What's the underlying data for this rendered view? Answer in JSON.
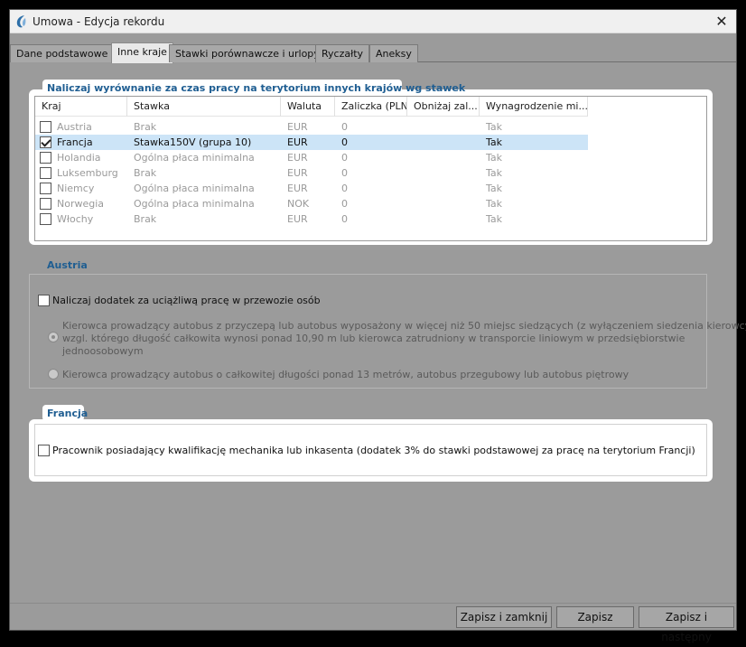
{
  "window": {
    "title": "Umowa - Edycja rekordu"
  },
  "tabs": [
    {
      "label": "Dane podstawowe"
    },
    {
      "label": "Inne kraje"
    },
    {
      "label": "Stawki porównawcze i urlopy"
    },
    {
      "label": "Ryczałty"
    },
    {
      "label": "Aneksy"
    }
  ],
  "countries_group": {
    "title": "Naliczaj wyrównanie za czas pracy na terytorium innych krajów wg stawek",
    "columns": [
      "Kraj",
      "Stawka",
      "Waluta",
      "Zaliczka (PLN)",
      "Obniżaj zal...",
      "Wynagrodzenie mi..."
    ],
    "rows": [
      {
        "checked": false,
        "country": "Austria",
        "rate": "Brak",
        "currency": "EUR",
        "advance": "0",
        "reduce": "",
        "min_wage": "Tak"
      },
      {
        "checked": true,
        "country": "Francja",
        "rate": "Stawka150V (grupa 10)",
        "currency": "EUR",
        "advance": "0",
        "reduce": "",
        "min_wage": "Tak"
      },
      {
        "checked": false,
        "country": "Holandia",
        "rate": "Ogólna płaca minimalna",
        "currency": "EUR",
        "advance": "0",
        "reduce": "",
        "min_wage": "Tak"
      },
      {
        "checked": false,
        "country": "Luksemburg",
        "rate": "Brak",
        "currency": "EUR",
        "advance": "0",
        "reduce": "",
        "min_wage": "Tak"
      },
      {
        "checked": false,
        "country": "Niemcy",
        "rate": "Ogólna płaca minimalna",
        "currency": "EUR",
        "advance": "0",
        "reduce": "",
        "min_wage": "Tak"
      },
      {
        "checked": false,
        "country": "Norwegia",
        "rate": "Ogólna płaca minimalna",
        "currency": "NOK",
        "advance": "0",
        "reduce": "",
        "min_wage": "Tak"
      },
      {
        "checked": false,
        "country": "Włochy",
        "rate": "Brak",
        "currency": "EUR",
        "advance": "0",
        "reduce": "",
        "min_wage": "Tak"
      }
    ]
  },
  "austria_group": {
    "title": "Austria",
    "checkbox_label": "Naliczaj dodatek za uciążliwą pracę w przewozie osób",
    "radio1_line1": "Kierowca prowadzący autobus z przyczepą lub autobus wyposażony w więcej niż 50 miejsc siedzących (z wyłączeniem siedzenia kierowcy)",
    "radio1_line2": "wzgl. którego długość całkowita wynosi ponad 10,90 m lub kierowca zatrudniony w transporcie liniowym w przedsiębiorstwie",
    "radio1_line3": "jednoosobowym",
    "radio2_label": "Kierowca prowadzący autobus o całkowitej długości ponad 13 metrów, autobus przegubowy lub autobus piętrowy"
  },
  "france_group": {
    "title": "Francja",
    "checkbox_label": "Pracownik posiadający kwalifikację mechanika lub inkasenta (dodatek 3% do stawki podstawowej za pracę na terytorium Francji)"
  },
  "buttons": {
    "save_close": "Zapisz i zamknij",
    "save": "Zapisz",
    "save_next": "Zapisz i następny"
  }
}
